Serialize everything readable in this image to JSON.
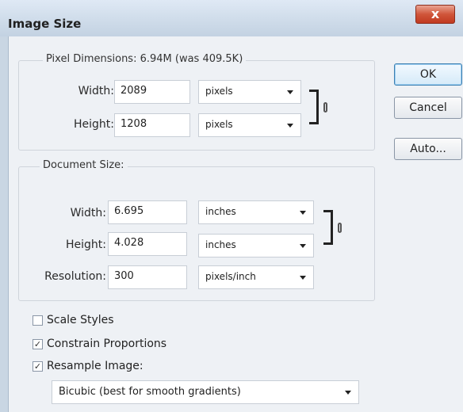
{
  "window": {
    "title": "Image Size",
    "close_glyph": "x"
  },
  "pixel_dimensions": {
    "legend": "Pixel Dimensions: 6.94M (was 409.5K)",
    "width_label": "Width:",
    "width_value": "2089",
    "width_unit": "pixels",
    "height_label": "Height:",
    "height_value": "1208",
    "height_unit": "pixels"
  },
  "document_size": {
    "legend": "Document Size:",
    "width_label": "Width:",
    "width_value": "6.695",
    "width_unit": "inches",
    "height_label": "Height:",
    "height_value": "4.028",
    "height_unit": "inches",
    "resolution_label": "Resolution:",
    "resolution_value": "300",
    "resolution_unit": "pixels/inch"
  },
  "buttons": {
    "ok": "OK",
    "cancel": "Cancel",
    "auto": "Auto..."
  },
  "options": {
    "scale_styles": {
      "label": "Scale Styles",
      "checked": false
    },
    "constrain_proportions": {
      "label": "Constrain Proportions",
      "checked": true
    },
    "resample_image": {
      "label": "Resample Image:",
      "checked": true
    },
    "resample_method": "Bicubic (best for smooth gradients)"
  },
  "icons": {
    "link": "chain-link-icon",
    "dropdown": "dropdown-arrow-icon",
    "check": "✓"
  }
}
